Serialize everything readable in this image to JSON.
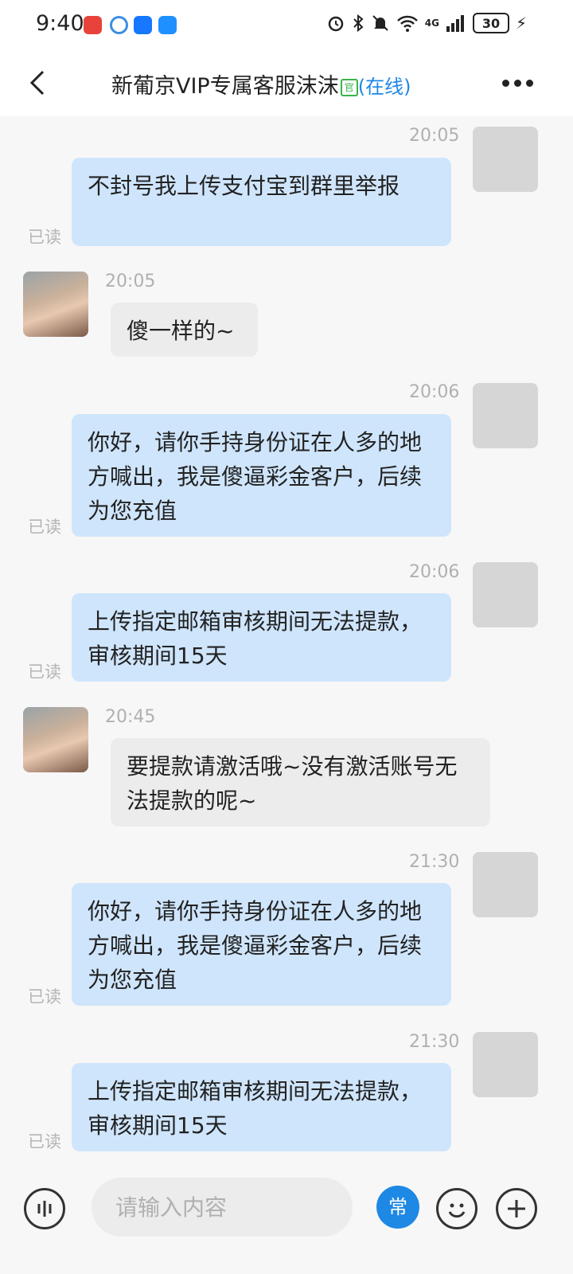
{
  "status_bar": {
    "time": "9:40",
    "network": "4G",
    "battery": "30"
  },
  "header": {
    "title": "新葡京VIP专属客服沫沫",
    "badge": "官",
    "status": "(在线)"
  },
  "messages": [
    {
      "side": "self",
      "time": "20:05",
      "text": "不封号我上传支付宝到群里举报",
      "read": "已读"
    },
    {
      "side": "other",
      "time": "20:05",
      "text": "傻一样的~"
    },
    {
      "side": "self",
      "time": "20:06",
      "text": "你好，请你手持身份证在人多的地方喊出，我是傻逼彩金客户，后续为您充值",
      "read": "已读"
    },
    {
      "side": "self",
      "time": "20:06",
      "text": "上传指定邮箱审核期间无法提款，审核期间15天",
      "read": "已读"
    },
    {
      "side": "other",
      "time": "20:45",
      "text": "要提款请激活哦~没有激活账号无法提款的呢~"
    },
    {
      "side": "self",
      "time": "21:30",
      "text": "你好，请你手持身份证在人多的地方喊出，我是傻逼彩金客户，后续为您充值",
      "read": "已读"
    },
    {
      "side": "self",
      "time": "21:30",
      "text": "上传指定邮箱审核期间无法提款，审核期间15天",
      "read": "已读"
    }
  ],
  "input_bar": {
    "placeholder": "请输入内容",
    "common_label": "常"
  },
  "colors": {
    "self_bubble": "#cfe5fc",
    "other_bubble": "#ececec",
    "accent": "#1e88e5",
    "online_badge": "#3bb34a"
  },
  "icons": [
    "back-arrow-icon",
    "more-dots-icon",
    "voice-icon",
    "emoji-icon",
    "plus-icon",
    "alarm-icon",
    "bluetooth-icon",
    "mute-icon",
    "wifi-icon",
    "signal-icon",
    "charging-icon"
  ]
}
